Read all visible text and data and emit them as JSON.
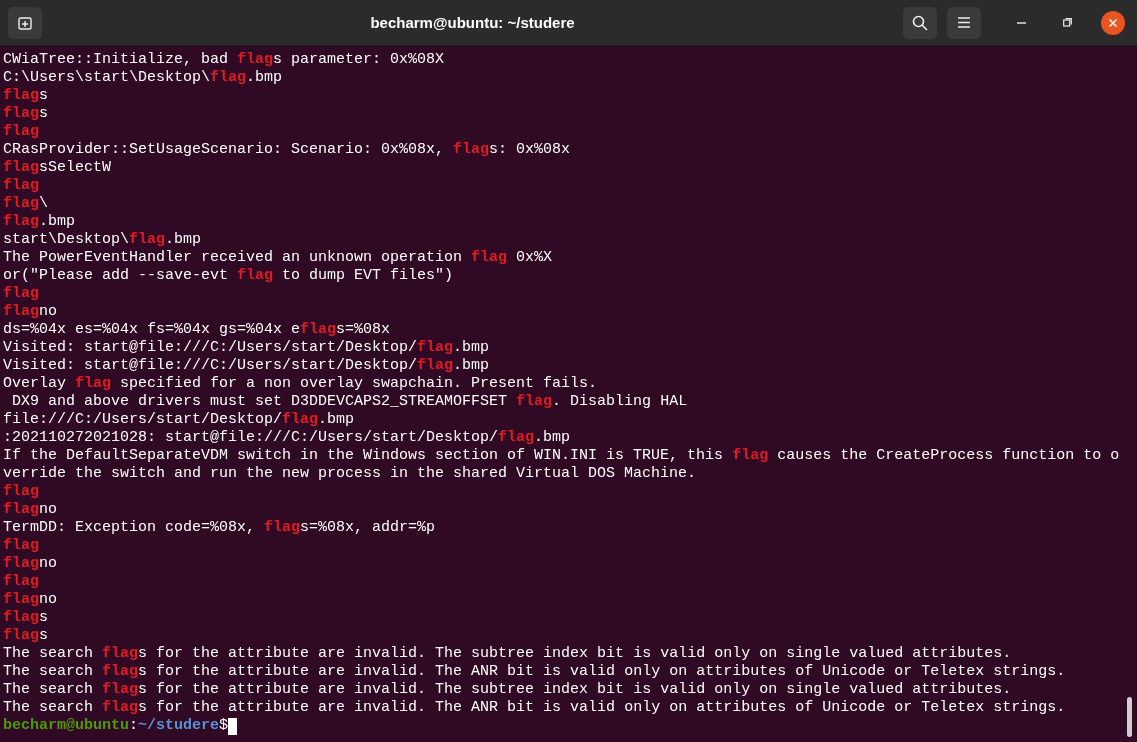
{
  "window": {
    "title": "becharm@ubuntu: ~/studere"
  },
  "lines": [
    "CWiaTree::Initialize, bad **flag**s parameter: 0x%08X",
    "C:\\Users\\start\\Desktop\\**flag**.bmp",
    "**flag**s",
    "**flag**s",
    "**flag**",
    "CRasProvider::SetUsageScenario: Scenario: 0x%08x, **flag**s: 0x%08x",
    "**flag**sSelectW",
    "**flag**",
    "**flag**\\",
    "**flag**.bmp",
    "start\\Desktop\\**flag**.bmp",
    "The PowerEventHandler received an unknown operation **flag** 0x%X",
    "or(\"Please add --save-evt **flag** to dump EVT files\")",
    "**flag**",
    "**flag**no",
    "ds=%04x es=%04x fs=%04x gs=%04x e**flag**s=%08x",
    "Visited: start@file:///C:/Users/start/Desktop/**flag**.bmp",
    "Visited: start@file:///C:/Users/start/Desktop/**flag**.bmp",
    "Overlay **flag** specified for a non overlay swapchain. Present fails.",
    " DX9 and above drivers must set D3DDEVCAPS2_STREAMOFFSET **flag**. Disabling HAL",
    "file:///C:/Users/start/Desktop/**flag**.bmp",
    ":202110272021028: start@file:///C:/Users/start/Desktop/**flag**.bmp",
    "If the DefaultSeparateVDM switch in the Windows section of WIN.INI is TRUE, this **flag** causes the CreateProcess function to o",
    "verride the switch and run the new process in the shared Virtual DOS Machine.",
    "**flag**",
    "**flag**no",
    "TermDD: Exception code=%08x, **flag**s=%08x, addr=%p",
    "**flag**",
    "**flag**no",
    "**flag**",
    "**flag**no",
    "**flag**s",
    "**flag**s",
    "The search **flag**s for the attribute are invalid. The subtree index bit is valid only on single valued attributes.",
    "The search **flag**s for the attribute are invalid. The ANR bit is valid only on attributes of Unicode or Teletex strings.",
    "The search **flag**s for the attribute are invalid. The subtree index bit is valid only on single valued attributes.",
    "The search **flag**s for the attribute are invalid. The ANR bit is valid only on attributes of Unicode or Teletex strings."
  ],
  "prompt": {
    "user_host": "becharm@ubuntu",
    "separator": ":",
    "path": "~/studere",
    "symbol": "$"
  }
}
